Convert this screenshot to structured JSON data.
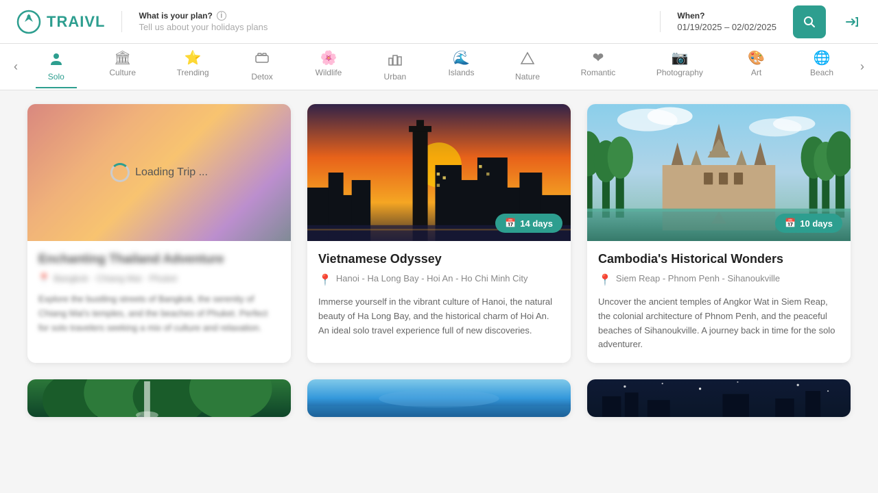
{
  "header": {
    "logo_text": "TRAIVL",
    "plan_label": "What is your plan?",
    "plan_placeholder": "Tell us about your holidays plans",
    "date_label": "When?",
    "date_value": "01/19/2025 – 02/02/2025",
    "search_label": "Search",
    "login_label": "Login"
  },
  "nav": {
    "prev_label": "‹",
    "next_label": "›",
    "items": [
      {
        "id": "solo",
        "label": "Solo",
        "icon": "👤",
        "active": true
      },
      {
        "id": "culture",
        "label": "Culture",
        "icon": "🏛",
        "active": false
      },
      {
        "id": "trending",
        "label": "Trending",
        "icon": "⭐",
        "active": false
      },
      {
        "id": "detox",
        "label": "Detox",
        "icon": "🏠",
        "active": false
      },
      {
        "id": "wildlife",
        "label": "Wildlife",
        "icon": "🌸",
        "active": false
      },
      {
        "id": "urban",
        "label": "Urban",
        "icon": "🏙",
        "active": false
      },
      {
        "id": "islands",
        "label": "Islands",
        "icon": "🌊",
        "active": false
      },
      {
        "id": "nature",
        "label": "Nature",
        "icon": "🏔",
        "active": false
      },
      {
        "id": "romantic",
        "label": "Romantic",
        "icon": "❤",
        "active": false
      },
      {
        "id": "photography",
        "label": "Photography",
        "icon": "📷",
        "active": false
      },
      {
        "id": "art",
        "label": "Art",
        "icon": "🎨",
        "active": false
      },
      {
        "id": "beach",
        "label": "Beach",
        "icon": "🌐",
        "active": false
      }
    ]
  },
  "cards": [
    {
      "id": "thailand",
      "loading": true,
      "title": "Enchanting Thailand Adventure",
      "location": "Bangkok · Chiang Mai · Phuket",
      "description": "Explore the bustling streets of Bangkok, the serenity of Chiang Mai's temples, and the beaches of Phuket. Perfect for solo travelers seeking a mix of culture and relaxation.",
      "days": null,
      "loading_text": "Loading Trip ..."
    },
    {
      "id": "vietnam",
      "loading": false,
      "title": "Vietnamese Odyssey",
      "location": "Hanoi - Ha Long Bay - Hoi An - Ho Chi Minh City",
      "description": "Immerse yourself in the vibrant culture of Hanoi, the natural beauty of Ha Long Bay, and the historical charm of Hoi An. An ideal solo travel experience full of new discoveries.",
      "days": 14
    },
    {
      "id": "cambodia",
      "loading": false,
      "title": "Cambodia's Historical Wonders",
      "location": "Siem Reap - Phnom Penh - Sihanoukville",
      "description": "Uncover the ancient temples of Angkor Wat in Siem Reap, the colonial architecture of Phnom Penh, and the peaceful beaches of Sihanoukville. A journey back in time for the solo adventurer.",
      "days": 10
    }
  ],
  "bottom_cards": [
    {
      "id": "bottom1",
      "type": "forest"
    },
    {
      "id": "bottom2",
      "type": "ocean"
    },
    {
      "id": "bottom3",
      "type": "night"
    }
  ],
  "badges": {
    "days_suffix": "days",
    "calendar_icon": "📅"
  }
}
